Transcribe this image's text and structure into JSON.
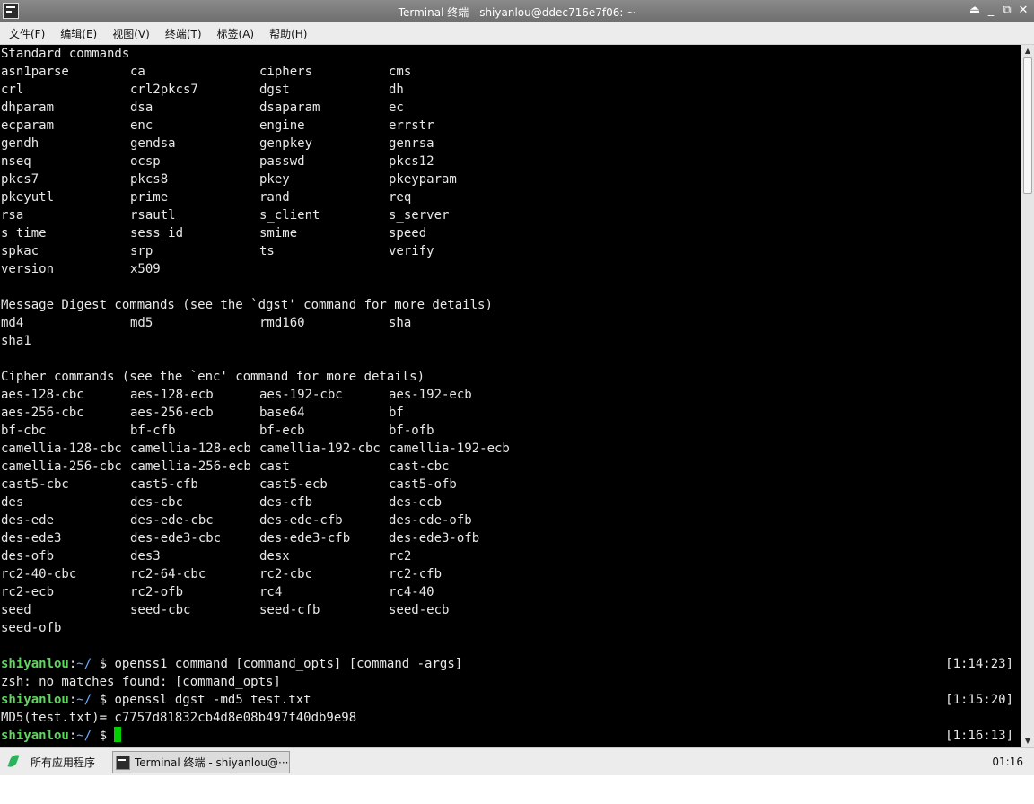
{
  "window": {
    "title": "Terminal 终端 - shiyanlou@ddec716e7f06: ~",
    "buttons": [
      "⏏",
      "_",
      "⧉",
      "✕"
    ]
  },
  "menu": [
    "文件(F)",
    "编辑(E)",
    "视图(V)",
    "终端(T)",
    "标签(A)",
    "帮助(H)"
  ],
  "terminal": {
    "header_standard": "Standard commands",
    "standard_rows": [
      [
        "asn1parse",
        "ca",
        "ciphers",
        "cms"
      ],
      [
        "crl",
        "crl2pkcs7",
        "dgst",
        "dh"
      ],
      [
        "dhparam",
        "dsa",
        "dsaparam",
        "ec"
      ],
      [
        "ecparam",
        "enc",
        "engine",
        "errstr"
      ],
      [
        "gendh",
        "gendsa",
        "genpkey",
        "genrsa"
      ],
      [
        "nseq",
        "ocsp",
        "passwd",
        "pkcs12"
      ],
      [
        "pkcs7",
        "pkcs8",
        "pkey",
        "pkeyparam"
      ],
      [
        "pkeyutl",
        "prime",
        "rand",
        "req"
      ],
      [
        "rsa",
        "rsautl",
        "s_client",
        "s_server"
      ],
      [
        "s_time",
        "sess_id",
        "smime",
        "speed"
      ],
      [
        "spkac",
        "srp",
        "ts",
        "verify"
      ],
      [
        "version",
        "x509",
        "",
        ""
      ]
    ],
    "header_digest": "Message Digest commands (see the `dgst' command for more details)",
    "digest_rows": [
      [
        "md4",
        "md5",
        "rmd160",
        "sha"
      ],
      [
        "sha1",
        "",
        "",
        ""
      ]
    ],
    "header_cipher": "Cipher commands (see the `enc' command for more details)",
    "cipher_rows": [
      [
        "aes-128-cbc",
        "aes-128-ecb",
        "aes-192-cbc",
        "aes-192-ecb"
      ],
      [
        "aes-256-cbc",
        "aes-256-ecb",
        "base64",
        "bf"
      ],
      [
        "bf-cbc",
        "bf-cfb",
        "bf-ecb",
        "bf-ofb"
      ],
      [
        "camellia-128-cbc",
        "camellia-128-ecb",
        "camellia-192-cbc",
        "camellia-192-ecb"
      ],
      [
        "camellia-256-cbc",
        "camellia-256-ecb",
        "cast",
        "cast-cbc"
      ],
      [
        "cast5-cbc",
        "cast5-cfb",
        "cast5-ecb",
        "cast5-ofb"
      ],
      [
        "des",
        "des-cbc",
        "des-cfb",
        "des-ecb"
      ],
      [
        "des-ede",
        "des-ede-cbc",
        "des-ede-cfb",
        "des-ede-ofb"
      ],
      [
        "des-ede3",
        "des-ede3-cbc",
        "des-ede3-cfb",
        "des-ede3-ofb"
      ],
      [
        "des-ofb",
        "des3",
        "desx",
        "rc2"
      ],
      [
        "rc2-40-cbc",
        "rc2-64-cbc",
        "rc2-cbc",
        "rc2-cfb"
      ],
      [
        "rc2-ecb",
        "rc2-ofb",
        "rc4",
        "rc4-40"
      ],
      [
        "seed",
        "seed-cbc",
        "seed-cfb",
        "seed-ecb"
      ],
      [
        "seed-ofb",
        "",
        "",
        ""
      ]
    ],
    "prompt": {
      "user": "shiyanlou",
      "sep": ":",
      "path": "~/",
      "symbol": " $ "
    },
    "session": [
      {
        "cmd": "openss1 command [command_opts] [command -args]",
        "time": "[1:14:23]"
      },
      {
        "output": "zsh: no matches found: [command_opts]"
      },
      {
        "cmd": "openssl dgst -md5 test.txt",
        "time": "[1:15:20]"
      },
      {
        "output": "MD5(test.txt)= c7757d81832cb4d8e08b497f40db9e98"
      },
      {
        "cmd": "",
        "time": "[1:16:13]"
      }
    ]
  },
  "taskbar": {
    "start_label": "所有应用程序",
    "task_label": "Terminal 终端 - shiyanlou@···",
    "clock": "01:16"
  },
  "colors": {
    "terminal_bg": "#000000",
    "terminal_fg": "#e8e8e8",
    "prompt_user": "#5fd75f",
    "prompt_path": "#6ab0ff",
    "cursor": "#00d000"
  }
}
